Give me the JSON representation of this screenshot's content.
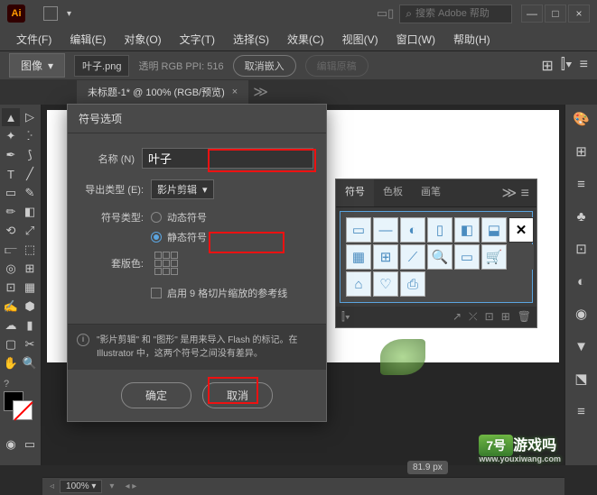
{
  "titlebar": {
    "logo": "Ai",
    "search_placeholder": "搜索 Adobe 帮助"
  },
  "menu": [
    "文件(F)",
    "编辑(E)",
    "对象(O)",
    "文字(T)",
    "选择(S)",
    "效果(C)",
    "视图(V)",
    "窗口(W)",
    "帮助(H)"
  ],
  "controlbar": {
    "image_btn": "图像",
    "filename": "叶子.png",
    "info": "透明 RGB PPI: 516",
    "cancel_embed": "取消嵌入",
    "edit_original": "编辑原稿"
  },
  "tab": {
    "title": "未标题-1* @ 100% (RGB/预览)"
  },
  "dialog": {
    "title": "符号选项",
    "name_label": "名称 (N)",
    "name_value": "叶子",
    "export_label": "导出类型 (E):",
    "export_value": "影片剪辑",
    "symbol_type_label": "符号类型:",
    "dynamic": "动态符号",
    "static": "静态符号",
    "registration_label": "套版色:",
    "scale_guides": "启用 9 格切片缩放的参考线",
    "info_text": "\"影片剪辑\" 和 \"图形\" 是用来导入 Flash 的标记。在 Illustrator 中，这两个符号之间没有差异。",
    "ok": "确定",
    "cancel": "取消"
  },
  "panel": {
    "tabs": [
      "符号",
      "色板",
      "画笔"
    ],
    "footer_count": ""
  },
  "px_label": "81.9 px",
  "statusbar": {
    "zoom": "100%"
  },
  "watermark": {
    "url": "www.youxiwang.com",
    "brand": "7号",
    "text": "游戏吗"
  }
}
